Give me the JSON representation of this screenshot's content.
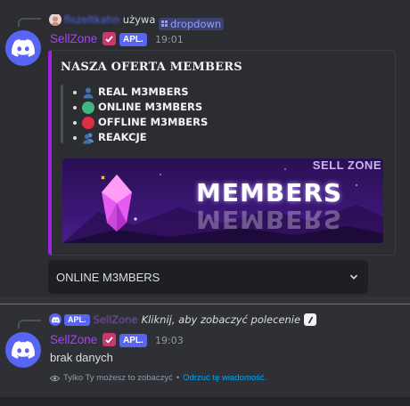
{
  "colors": {
    "bg": "#313338",
    "message_bg": "#2b2d31",
    "blurple": "#5865f2",
    "username": "#a640ff",
    "embed_accent": "#a120e6",
    "link": "#00a8fc",
    "new_divider": "#f23f42"
  },
  "message1": {
    "reply": {
      "user_blurred": "fiszeltkahn",
      "verb": "używa",
      "command": "dropdown"
    },
    "author": {
      "name": "SellZone",
      "app_tag": "APL.",
      "time": "19:01",
      "avatar_icon": "discord-logo-icon"
    },
    "embed": {
      "title": "NASZA OFERTA MEMBERS",
      "items": [
        {
          "icon": "bust-in-silhouette-icon",
          "label": "REAL M3MBERS"
        },
        {
          "icon": "green-circle-icon",
          "label": "ONLINE M3MBERS"
        },
        {
          "icon": "red-circle-icon",
          "label": "OFFLINE M3MBERS"
        },
        {
          "icon": "busts-in-silhouette-icon",
          "label": "REAKCJE"
        }
      ],
      "banner": {
        "brand": "SELL ZONE",
        "word": "MEMBERS"
      }
    },
    "dropdown": {
      "selected": "ONLINE M3MBERS"
    }
  },
  "message2": {
    "reply": {
      "app_tag": "APL.",
      "user": "SellZone",
      "text": "Kliknij, aby zobaczyć polecenie"
    },
    "author": {
      "name": "SellZone",
      "app_tag": "APL.",
      "time": "19:03"
    },
    "content": "brak danych",
    "ephemeral": {
      "notice": "Tylko Ty możesz to zobaczyć",
      "separator": "•",
      "dismiss": "Odrzuć tę wiadomość."
    }
  }
}
